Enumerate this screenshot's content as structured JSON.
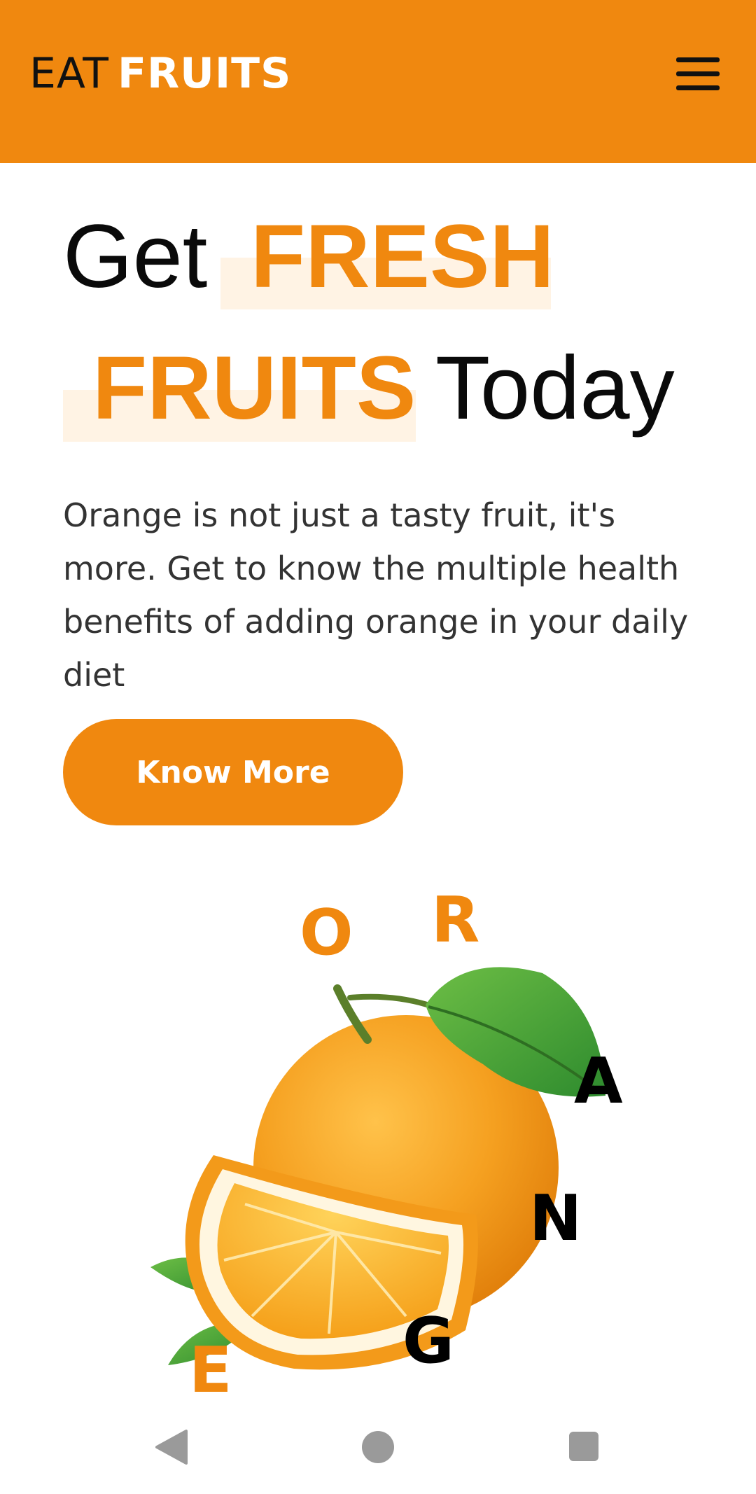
{
  "header": {
    "brand_word1": "EAT",
    "brand_word2": "FRUITS",
    "menu_icon": "hamburger-menu-icon",
    "background": "#F0880F"
  },
  "hero": {
    "line1_word1": "Get",
    "line1_word2": "FRESH",
    "line2_word1": "FRUITS",
    "line2_word2": "Today",
    "description": "Orange is not just a tasty fruit, it's more. Get to know the multiple health benefits of adding orange in your daily diet",
    "cta_label": "Know More",
    "accent_color": "#F0880F",
    "highlight_color": "#FFF3E4"
  },
  "illustration": {
    "letters": [
      "O",
      "R",
      "A",
      "N",
      "G",
      "E"
    ],
    "image": "orange-with-slice-and-leaves"
  },
  "system_nav": {
    "back_icon": "back-triangle-icon",
    "home_icon": "home-circle-icon",
    "recents_icon": "recents-square-icon"
  }
}
